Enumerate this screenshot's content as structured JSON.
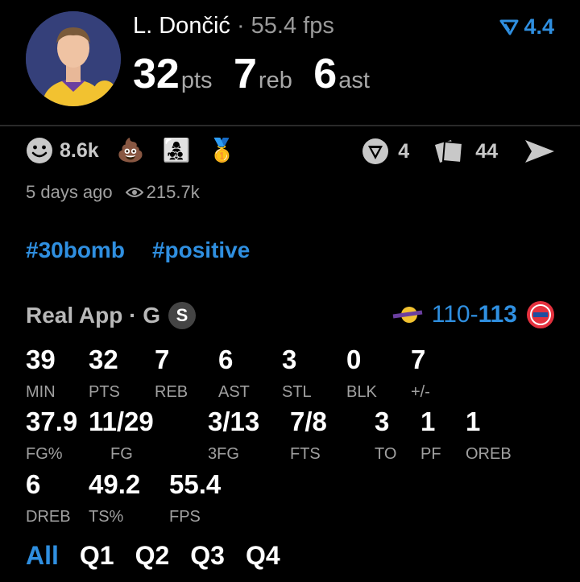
{
  "header": {
    "player_name": "L. Dončić",
    "separator": " · ",
    "fps": "55.4 fps",
    "vote_icon": "downvote-arrow-icon",
    "vote_value": "4.4",
    "pts": "32",
    "pts_label": "pts",
    "reb": "7",
    "reb_label": "reb",
    "ast": "6",
    "ast_label": "ast"
  },
  "reactions": {
    "smile_count": "8.6k",
    "emoji_1": "💩",
    "emoji_2": "👩‍👧‍👦",
    "emoji_3": "🥇",
    "comment_count": "4",
    "card_count": "44"
  },
  "meta": {
    "time_ago": "5 days ago",
    "views": "215.7k"
  },
  "tags": [
    "#30bomb",
    "#positive"
  ],
  "game": {
    "source": "Real App · G",
    "badge": "S",
    "score_left": "110-",
    "score_right": "113"
  },
  "stats_row1": [
    {
      "v": "39",
      "l": "MIN"
    },
    {
      "v": "32",
      "l": "PTS"
    },
    {
      "v": "7",
      "l": "REB"
    },
    {
      "v": "6",
      "l": "AST"
    },
    {
      "v": "3",
      "l": "STL"
    },
    {
      "v": "0",
      "l": "BLK"
    },
    {
      "v": "7",
      "l": "+/-"
    }
  ],
  "stats_row2": [
    {
      "v": "37.9",
      "l": "FG%"
    },
    {
      "v": "11/29",
      "l": "FG"
    },
    {
      "v": "3/13",
      "l": "3FG"
    },
    {
      "v": "7/8",
      "l": "FTS"
    },
    {
      "v": "3",
      "l": "TO"
    },
    {
      "v": "1",
      "l": "PF"
    },
    {
      "v": "1",
      "l": "OREB"
    }
  ],
  "stats_row3": [
    {
      "v": "6",
      "l": "DREB"
    },
    {
      "v": "49.2",
      "l": "TS%"
    },
    {
      "v": "55.4",
      "l": "FPS"
    }
  ],
  "tabs": [
    "All",
    "Q1",
    "Q2",
    "Q3",
    "Q4"
  ],
  "colors": {
    "accent": "#2f8fe0",
    "positive": "#2fae62",
    "background": "#000000"
  }
}
